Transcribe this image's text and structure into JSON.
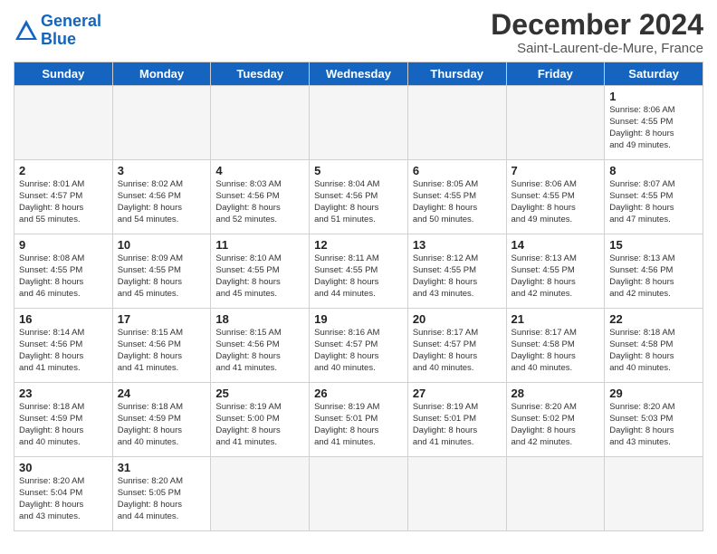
{
  "header": {
    "logo_line1": "General",
    "logo_line2": "Blue",
    "month": "December 2024",
    "location": "Saint-Laurent-de-Mure, France"
  },
  "weekdays": [
    "Sunday",
    "Monday",
    "Tuesday",
    "Wednesday",
    "Thursday",
    "Friday",
    "Saturday"
  ],
  "days": [
    {
      "num": "",
      "text": "",
      "empty": true
    },
    {
      "num": "",
      "text": "",
      "empty": true
    },
    {
      "num": "",
      "text": "",
      "empty": true
    },
    {
      "num": "",
      "text": "",
      "empty": true
    },
    {
      "num": "",
      "text": "",
      "empty": true
    },
    {
      "num": "",
      "text": "",
      "empty": true
    },
    {
      "num": "1",
      "text": "Sunrise: 8:06 AM\nSunset: 4:55 PM\nDaylight: 8 hours\nand 49 minutes."
    },
    {
      "num": "2",
      "text": "Sunrise: 8:01 AM\nSunset: 4:57 PM\nDaylight: 8 hours\nand 55 minutes."
    },
    {
      "num": "3",
      "text": "Sunrise: 8:02 AM\nSunset: 4:56 PM\nDaylight: 8 hours\nand 54 minutes."
    },
    {
      "num": "4",
      "text": "Sunrise: 8:03 AM\nSunset: 4:56 PM\nDaylight: 8 hours\nand 52 minutes."
    },
    {
      "num": "5",
      "text": "Sunrise: 8:04 AM\nSunset: 4:56 PM\nDaylight: 8 hours\nand 51 minutes."
    },
    {
      "num": "6",
      "text": "Sunrise: 8:05 AM\nSunset: 4:55 PM\nDaylight: 8 hours\nand 50 minutes."
    },
    {
      "num": "7",
      "text": "Sunrise: 8:06 AM\nSunset: 4:55 PM\nDaylight: 8 hours\nand 49 minutes."
    },
    {
      "num": "8",
      "text": "Sunrise: 8:07 AM\nSunset: 4:55 PM\nDaylight: 8 hours\nand 47 minutes."
    },
    {
      "num": "9",
      "text": "Sunrise: 8:08 AM\nSunset: 4:55 PM\nDaylight: 8 hours\nand 46 minutes."
    },
    {
      "num": "10",
      "text": "Sunrise: 8:09 AM\nSunset: 4:55 PM\nDaylight: 8 hours\nand 45 minutes."
    },
    {
      "num": "11",
      "text": "Sunrise: 8:10 AM\nSunset: 4:55 PM\nDaylight: 8 hours\nand 45 minutes."
    },
    {
      "num": "12",
      "text": "Sunrise: 8:11 AM\nSunset: 4:55 PM\nDaylight: 8 hours\nand 44 minutes."
    },
    {
      "num": "13",
      "text": "Sunrise: 8:12 AM\nSunset: 4:55 PM\nDaylight: 8 hours\nand 43 minutes."
    },
    {
      "num": "14",
      "text": "Sunrise: 8:13 AM\nSunset: 4:55 PM\nDaylight: 8 hours\nand 42 minutes."
    },
    {
      "num": "15",
      "text": "Sunrise: 8:13 AM\nSunset: 4:56 PM\nDaylight: 8 hours\nand 42 minutes."
    },
    {
      "num": "16",
      "text": "Sunrise: 8:14 AM\nSunset: 4:56 PM\nDaylight: 8 hours\nand 41 minutes."
    },
    {
      "num": "17",
      "text": "Sunrise: 8:15 AM\nSunset: 4:56 PM\nDaylight: 8 hours\nand 41 minutes."
    },
    {
      "num": "18",
      "text": "Sunrise: 8:15 AM\nSunset: 4:56 PM\nDaylight: 8 hours\nand 41 minutes."
    },
    {
      "num": "19",
      "text": "Sunrise: 8:16 AM\nSunset: 4:57 PM\nDaylight: 8 hours\nand 40 minutes."
    },
    {
      "num": "20",
      "text": "Sunrise: 8:17 AM\nSunset: 4:57 PM\nDaylight: 8 hours\nand 40 minutes."
    },
    {
      "num": "21",
      "text": "Sunrise: 8:17 AM\nSunset: 4:58 PM\nDaylight: 8 hours\nand 40 minutes."
    },
    {
      "num": "22",
      "text": "Sunrise: 8:18 AM\nSunset: 4:58 PM\nDaylight: 8 hours\nand 40 minutes."
    },
    {
      "num": "23",
      "text": "Sunrise: 8:18 AM\nSunset: 4:59 PM\nDaylight: 8 hours\nand 40 minutes."
    },
    {
      "num": "24",
      "text": "Sunrise: 8:18 AM\nSunset: 4:59 PM\nDaylight: 8 hours\nand 40 minutes."
    },
    {
      "num": "25",
      "text": "Sunrise: 8:19 AM\nSunset: 5:00 PM\nDaylight: 8 hours\nand 41 minutes."
    },
    {
      "num": "26",
      "text": "Sunrise: 8:19 AM\nSunset: 5:01 PM\nDaylight: 8 hours\nand 41 minutes."
    },
    {
      "num": "27",
      "text": "Sunrise: 8:19 AM\nSunset: 5:01 PM\nDaylight: 8 hours\nand 41 minutes."
    },
    {
      "num": "28",
      "text": "Sunrise: 8:20 AM\nSunset: 5:02 PM\nDaylight: 8 hours\nand 42 minutes."
    },
    {
      "num": "29",
      "text": "Sunrise: 8:20 AM\nSunset: 5:03 PM\nDaylight: 8 hours\nand 43 minutes."
    },
    {
      "num": "30",
      "text": "Sunrise: 8:20 AM\nSunset: 5:04 PM\nDaylight: 8 hours\nand 43 minutes."
    },
    {
      "num": "31",
      "text": "Sunrise: 8:20 AM\nSunset: 5:05 PM\nDaylight: 8 hours\nand 44 minutes."
    },
    {
      "num": "",
      "text": "",
      "empty": true
    },
    {
      "num": "",
      "text": "",
      "empty": true
    },
    {
      "num": "",
      "text": "",
      "empty": true
    },
    {
      "num": "",
      "text": "",
      "empty": true
    }
  ]
}
